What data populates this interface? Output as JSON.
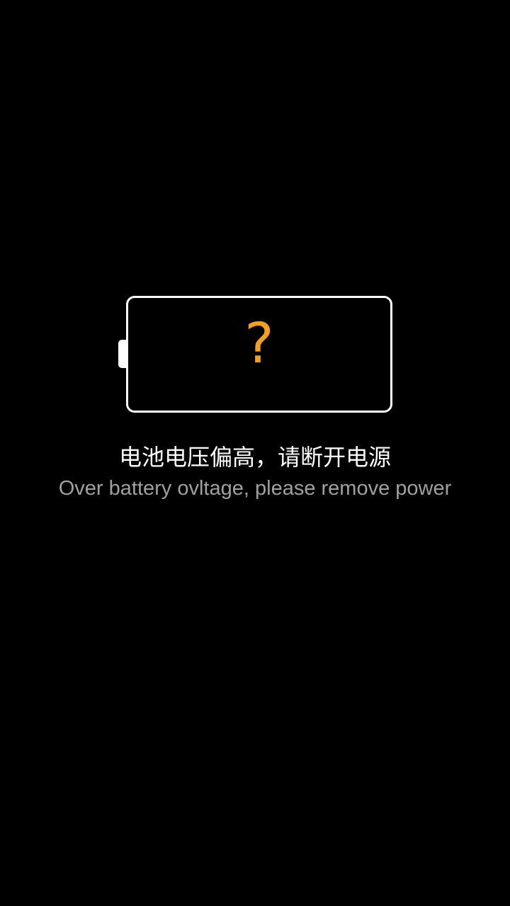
{
  "battery": {
    "icon": "battery-unknown-icon",
    "status_symbol": "?",
    "outline_color": "#ffffff",
    "symbol_color": "#f5a01a"
  },
  "message": {
    "chinese": "电池电压偏高，请断开电源",
    "english": "Over battery ovltage, please remove power"
  },
  "colors": {
    "background": "#000000",
    "primary_text": "#ffffff",
    "secondary_text": "#a0a0a0"
  }
}
